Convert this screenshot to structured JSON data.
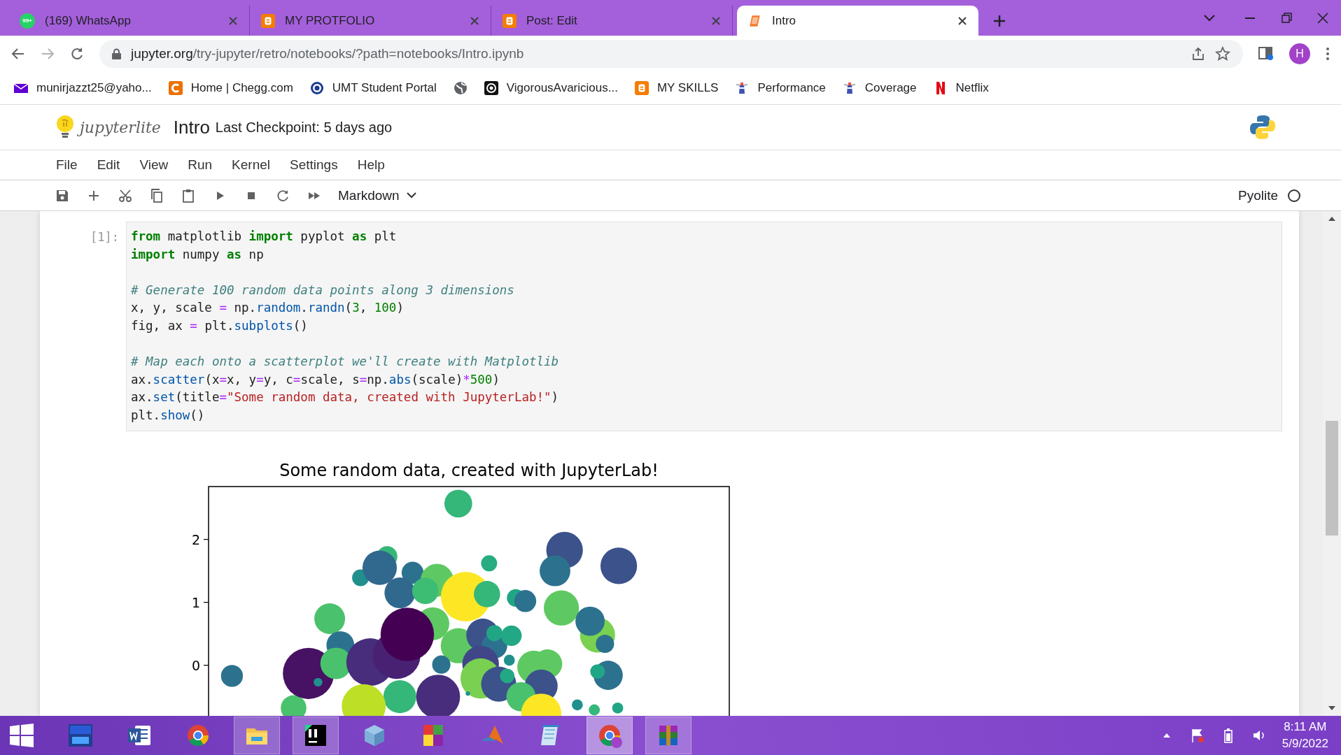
{
  "browser": {
    "tabs": [
      {
        "kind": "whatsapp",
        "title": "(169) WhatsApp",
        "badge": "99+",
        "selected": false
      },
      {
        "kind": "blogger",
        "title": "MY PROTFOLIO",
        "selected": false
      },
      {
        "kind": "blogger",
        "title": "Post: Edit",
        "selected": false
      },
      {
        "kind": "notebook",
        "title": "Intro",
        "selected": true
      }
    ],
    "url_host": "jupyter.org",
    "url_path": "/try-jupyter/retro/notebooks/?path=notebooks/Intro.ipynb",
    "profile": "H",
    "bookmarks": [
      {
        "kind": "mail",
        "label": "munirjazzt25@yaho..."
      },
      {
        "kind": "chegg",
        "label": "Home | Chegg.com"
      },
      {
        "kind": "seal",
        "label": "UMT Student Portal"
      },
      {
        "kind": "globe"
      },
      {
        "kind": "swirl",
        "label": "VigorousAvaricious..."
      },
      {
        "kind": "blogger",
        "label": "MY SKILLS"
      },
      {
        "kind": "lighthouse",
        "label": "Performance"
      },
      {
        "kind": "lighthouse",
        "label": "Coverage"
      },
      {
        "kind": "netflix",
        "label": "Netflix"
      }
    ]
  },
  "notebook": {
    "logo": "jupyterlite",
    "name": "Intro",
    "checkpoint": "Last Checkpoint: 5 days ago",
    "menu": [
      "File",
      "Edit",
      "View",
      "Run",
      "Kernel",
      "Settings",
      "Help"
    ],
    "cell_type": "Markdown",
    "kernel": {
      "name": "Pyolite",
      "busy": false
    },
    "cell": {
      "prompt": "[1]:",
      "lines": [
        {
          "kind": "code",
          "tokens": [
            {
              "kind": "keyword",
              "text": "from"
            },
            {
              "kind": "plain",
              "text": " matplotlib "
            },
            {
              "kind": "keyword",
              "text": "import"
            },
            {
              "kind": "plain",
              "text": " pyplot "
            },
            {
              "kind": "keyword",
              "text": "as"
            },
            {
              "kind": "plain",
              "text": " plt"
            }
          ]
        },
        {
          "kind": "code",
          "tokens": [
            {
              "kind": "keyword",
              "text": "import"
            },
            {
              "kind": "plain",
              "text": " numpy "
            },
            {
              "kind": "keyword",
              "text": "as"
            },
            {
              "kind": "plain",
              "text": " np"
            }
          ]
        },
        {
          "kind": "blank"
        },
        {
          "kind": "code",
          "tokens": [
            {
              "kind": "comment",
              "text": "# Generate 100 random data points along 3 dimensions"
            }
          ]
        },
        {
          "kind": "code",
          "tokens": [
            {
              "kind": "plain",
              "text": "x, y, scale "
            },
            {
              "kind": "operator",
              "text": "="
            },
            {
              "kind": "plain",
              "text": " np."
            },
            {
              "kind": "function",
              "text": "random"
            },
            {
              "kind": "plain",
              "text": "."
            },
            {
              "kind": "function",
              "text": "randn"
            },
            {
              "kind": "plain",
              "text": "("
            },
            {
              "kind": "number",
              "text": "3"
            },
            {
              "kind": "plain",
              "text": ", "
            },
            {
              "kind": "number",
              "text": "100"
            },
            {
              "kind": "plain",
              "text": ")"
            }
          ]
        },
        {
          "kind": "code",
          "tokens": [
            {
              "kind": "plain",
              "text": "fig, ax "
            },
            {
              "kind": "operator",
              "text": "="
            },
            {
              "kind": "plain",
              "text": " plt."
            },
            {
              "kind": "function",
              "text": "subplots"
            },
            {
              "kind": "plain",
              "text": "()"
            }
          ]
        },
        {
          "kind": "blank"
        },
        {
          "kind": "code",
          "tokens": [
            {
              "kind": "comment",
              "text": "# Map each onto a scatterplot we'll create with Matplotlib"
            }
          ]
        },
        {
          "kind": "code",
          "tokens": [
            {
              "kind": "plain",
              "text": "ax."
            },
            {
              "kind": "function",
              "text": "scatter"
            },
            {
              "kind": "plain",
              "text": "(x"
            },
            {
              "kind": "operator",
              "text": "="
            },
            {
              "kind": "plain",
              "text": "x, y"
            },
            {
              "kind": "operator",
              "text": "="
            },
            {
              "kind": "plain",
              "text": "y, c"
            },
            {
              "kind": "operator",
              "text": "="
            },
            {
              "kind": "plain",
              "text": "scale, s"
            },
            {
              "kind": "operator",
              "text": "="
            },
            {
              "kind": "plain",
              "text": "np."
            },
            {
              "kind": "function",
              "text": "abs"
            },
            {
              "kind": "plain",
              "text": "(scale)"
            },
            {
              "kind": "operator",
              "text": "*"
            },
            {
              "kind": "number",
              "text": "500"
            },
            {
              "kind": "plain",
              "text": ")"
            }
          ]
        },
        {
          "kind": "code",
          "tokens": [
            {
              "kind": "plain",
              "text": "ax."
            },
            {
              "kind": "function",
              "text": "set"
            },
            {
              "kind": "plain",
              "text": "(title"
            },
            {
              "kind": "operator",
              "text": "="
            },
            {
              "kind": "string",
              "text": "\"Some random data, created with JupyterLab!\""
            },
            {
              "kind": "plain",
              "text": ")"
            }
          ]
        },
        {
          "kind": "code",
          "tokens": [
            {
              "kind": "plain",
              "text": "plt."
            },
            {
              "kind": "function",
              "text": "show"
            },
            {
              "kind": "plain",
              "text": "()"
            }
          ]
        }
      ]
    },
    "figure": {
      "title": "Some random data, created with JupyterLab!",
      "y_tick_labels": [
        "2",
        "1",
        "0"
      ]
    }
  },
  "taskbar": {
    "apps": [
      {
        "kind": "devcpp",
        "open": false,
        "selected": false
      },
      {
        "kind": "word",
        "open": false,
        "selected": false
      },
      {
        "kind": "chrome",
        "open": false,
        "selected": false
      },
      {
        "kind": "folder",
        "open": true,
        "selected": false
      },
      {
        "kind": "pycharm",
        "open": true,
        "selected": false
      },
      {
        "kind": "cube",
        "open": false,
        "selected": false
      },
      {
        "kind": "tiles",
        "open": false,
        "selected": false
      },
      {
        "kind": "peak",
        "open": false,
        "selected": false
      },
      {
        "kind": "notepad",
        "open": false,
        "selected": false
      },
      {
        "kind": "chrome-profile",
        "open": true,
        "selected": true
      },
      {
        "kind": "archive",
        "open": true,
        "selected": false
      }
    ],
    "time": "8:11 AM",
    "date": "5/9/2022"
  }
}
